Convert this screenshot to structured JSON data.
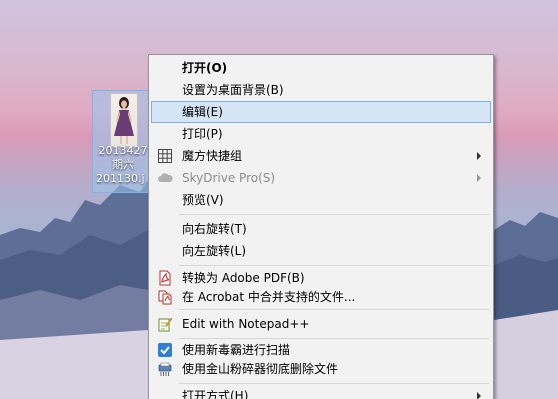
{
  "desktop_file": {
    "name_line1": "2013427",
    "name_line2": "期六",
    "name_line3": "201130.j"
  },
  "context_menu": {
    "items": [
      {
        "label": "打开(O)",
        "icon": "",
        "bold": true
      },
      {
        "label": "设置为桌面背景(B)",
        "icon": ""
      },
      {
        "label": "编辑(E)",
        "icon": "",
        "highlighted": true
      },
      {
        "label": "打印(P)",
        "icon": ""
      },
      {
        "label": "魔方快捷组",
        "icon": "grid-icon",
        "submenu": true
      },
      {
        "label": "SkyDrive Pro(S)",
        "icon": "cloud-icon",
        "submenu": true,
        "disabled": true
      },
      {
        "label": "预览(V)",
        "icon": ""
      },
      {
        "label": "向右旋转(T)",
        "icon": ""
      },
      {
        "label": "向左旋转(L)",
        "icon": ""
      },
      {
        "label": "转换为 Adobe PDF(B)",
        "icon": "pdf-icon"
      },
      {
        "label": "在 Acrobat 中合并支持的文件...",
        "icon": "acrobat-combine-icon"
      },
      {
        "label": "Edit with Notepad++",
        "icon": "notepad-plus-plus-icon"
      },
      {
        "label": "使用新毒霸进行扫描",
        "icon": "antivirus-scan-icon"
      },
      {
        "label": "使用金山粉碎器彻底删除文件",
        "icon": "file-shredder-icon"
      },
      {
        "label": "打开方式(H)",
        "icon": "",
        "submenu": true
      }
    ]
  },
  "colors": {
    "menu_bg": "#f2f2f2",
    "highlight_bg": "#d5e5f6",
    "highlight_border": "#7fb1e3",
    "separator": "#d7d7d7",
    "disabled_text": "#8c8c8c",
    "selection_bg": "#99c9ef"
  }
}
